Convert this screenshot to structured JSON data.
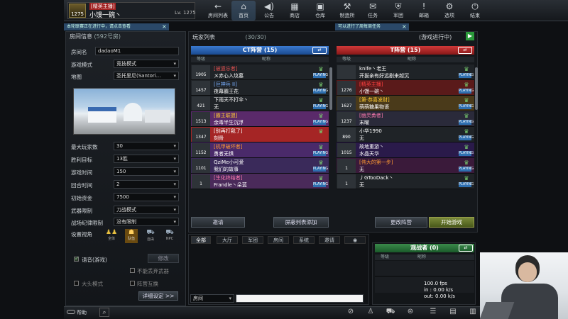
{
  "profile": {
    "title": "[精英主播]",
    "name": "小馒一碗丶",
    "level": "Lv. 1275",
    "rank": "1275"
  },
  "nav": [
    {
      "label": "房间列表",
      "icon": "back-arrow"
    },
    {
      "label": "首页",
      "icon": "home"
    },
    {
      "label": "公告",
      "icon": "speaker"
    },
    {
      "label": "商店",
      "icon": "shop"
    },
    {
      "label": "仓库",
      "icon": "warehouse"
    },
    {
      "label": "制造所",
      "icon": "craft"
    },
    {
      "label": "任务",
      "icon": "task"
    },
    {
      "label": "军团",
      "icon": "shield"
    },
    {
      "label": "邮箱",
      "icon": "mail"
    },
    {
      "label": "选项",
      "icon": "gear"
    },
    {
      "label": "结束",
      "icon": "power"
    }
  ],
  "banners": {
    "left": "本轮联赛正在进行中，请点击查看",
    "right": "可以进行了周每周任务"
  },
  "room": {
    "header": "房间信息",
    "room_no": "(592号房)",
    "fields": [
      {
        "label": "房间名",
        "value": "dadaoM1"
      },
      {
        "label": "游戏模式",
        "value": "竞技模式"
      },
      {
        "label": "地图",
        "value": "圣托里尼(Santori..."
      }
    ],
    "settings": [
      {
        "label": "最大玩家数",
        "value": "30"
      },
      {
        "label": "胜利目标",
        "value": "13胜"
      },
      {
        "label": "游戏时间",
        "value": "150"
      },
      {
        "label": "回合时间",
        "value": "2"
      },
      {
        "label": "初始资金",
        "value": "7500"
      },
      {
        "label": "武器限制",
        "value": "刀战模式"
      },
      {
        "label": "战场纪律限制",
        "value": "没有限制"
      }
    ],
    "view_label": "设置视角",
    "view_opts": [
      "全体",
      "队伍",
      "自由",
      "NPC"
    ],
    "voice_label": "语音(游戏)",
    "modify_btn": "修改",
    "no_weapon_switch": "不能丢弃武器",
    "big_head": "大头模式",
    "team_balance": "阵营互换",
    "detail_btn": "详细设定 >>",
    "help": "帮助"
  },
  "players": {
    "title": "玩家列表",
    "count": "(30/30)",
    "status": "(游戏进行中)",
    "col_level": "等级",
    "col_name": "昵称",
    "ct": {
      "name": "CT阵营 (15)",
      "slots": [
        {
          "lv": "1905",
          "n1": "[被遗忘者]",
          "n2": "メ赤心入坟墓",
          "c1": "#e05050",
          "status": "PLAYING",
          "bg": "#1f2327"
        },
        {
          "lv": "1457",
          "n1": "[巨神兵 II]",
          "n2": "夜幕霸王花",
          "c1": "#7ab0ff",
          "status": "PLAYING",
          "bg": "#1f2327"
        },
        {
          "lv": "421",
          "n1": "下雨天不打伞丶",
          "n2": "无",
          "c1": "#ffffff",
          "status": "PLAYING",
          "bg": "#1f2327"
        },
        {
          "lv": "1513",
          "n1": "[霸主联盟]",
          "n2": "余毒半生沉浮",
          "c1": "#ffcc33",
          "status": "PLAYING",
          "bg": "#5a2a6a"
        },
        {
          "lv": "1347",
          "n1": "[别再打我了]",
          "n2": "刻骨",
          "c1": "#ffffff",
          "status": "",
          "bg": "#a52525"
        },
        {
          "lv": "1152",
          "n1": "[机甲破坏者]",
          "n2": "勇者无惧",
          "c1": "#ff9933",
          "status": "PLAYING",
          "bg": "#4a2a6a"
        },
        {
          "lv": "1101",
          "n1": "QziMe小可爱",
          "n2": "我们的故事",
          "c1": "#ffffff",
          "status": "PLAYING",
          "bg": "#3a2a5a"
        },
        {
          "lv": "1",
          "n1": "[生化终结者]",
          "n2": "Frandle丶朵蓝",
          "c1": "#ff7ab0",
          "status": "PLAYING",
          "bg": "#4a2a5a"
        }
      ]
    },
    "t": {
      "name": "T阵营 (15)",
      "slots": [
        {
          "lv": "",
          "n1": "knife丶老王",
          "n2": "开拔亲有好远剧来越沉",
          "c1": "#ffffff",
          "status": "PLAYING",
          "bg": "#1f2327"
        },
        {
          "lv": "1276",
          "n1": "[精英主播]",
          "n2": "小馒一碗丶",
          "c1": "#ff4040",
          "status": "PLAYING",
          "bg": "#5a1a1a"
        },
        {
          "lv": "1627",
          "n1": "[第·恭喜发财]",
          "n2": "萌萌糖果物语",
          "c1": "#ffcc33",
          "status": "PLAYING",
          "bg": "#4a3a1a"
        },
        {
          "lv": "1237",
          "n1": "[幽灵勇者]",
          "n2": "末曜",
          "c1": "#ff7ab0",
          "status": "PLAYING",
          "bg": "#2a2a3a"
        },
        {
          "lv": "890",
          "n1": "小华1990",
          "n2": "无",
          "c1": "#ffffff",
          "status": "PLAYING",
          "bg": "#1f2327"
        },
        {
          "lv": "1015",
          "n1": "故地重游丶",
          "n2": "水晶天华",
          "c1": "#ffffff",
          "status": "PLAYING",
          "bg": "#2a1a4a"
        },
        {
          "lv": "1",
          "n1": "[伟大的第一步]",
          "n2": "无",
          "c1": "#ff9933",
          "status": "PLAYING",
          "bg": "#3a1a3a"
        },
        {
          "lv": "1",
          "n1": "丿GTooDack丶",
          "n2": "无",
          "c1": "#ffffff",
          "status": "PLAYING",
          "bg": "#1f2327"
        }
      ]
    },
    "btn_invite": "邀请",
    "btn_block": "屏蔽列表添加",
    "btn_change": "更改阵营",
    "btn_start": "开始游戏"
  },
  "chat": {
    "tabs": [
      "全部",
      "大厅",
      "军团",
      "房间",
      "系统",
      "邀请"
    ],
    "channel": "房间"
  },
  "observers": {
    "title": "观战者 (0)",
    "col_level": "等级",
    "col_name": "昵称"
  },
  "netstats": {
    "fps": "100.0 fps",
    "in": "in : 0.00 k/s",
    "out": "out: 0.00 k/s"
  },
  "colors": {
    "ct": "#2a6fc0",
    "t": "#b02222",
    "accent": "#3a6a9a",
    "start": "#6a7a30"
  }
}
